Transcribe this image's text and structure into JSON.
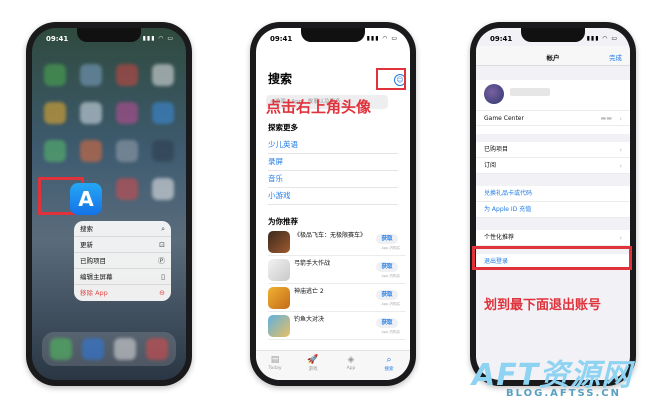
{
  "phone1": {
    "time": "09:41",
    "signal": "▮▮▮ ◠ ▭",
    "app_icon": "A",
    "menu": [
      {
        "label": "搜索",
        "icon": "search-icon",
        "glyph": "⌕"
      },
      {
        "label": "更新",
        "icon": "download-icon",
        "glyph": "⊡"
      },
      {
        "label": "已购项目",
        "icon": "purchased-icon",
        "glyph": "Ⓟ"
      },
      {
        "label": "编辑主屏幕",
        "icon": "phone-icon",
        "glyph": "▯"
      },
      {
        "label": "移除 App",
        "icon": "minus-circle-icon",
        "glyph": "⊖"
      }
    ],
    "danger_color": "#e24a4a"
  },
  "phone2": {
    "time": "09:41",
    "signal": "▮▮▮ ◠ ▭",
    "title": "搜索",
    "search_placeholder": "游戏、App、故事以及更多",
    "annotation": "点击右上角头像",
    "explore_heading": "探索更多",
    "explore_links": [
      "少儿英语",
      "录屏",
      "音乐",
      "小游戏"
    ],
    "recommend_heading": "为你推荐",
    "apps": [
      {
        "name": "《极品飞车：无极限赛车》",
        "get": "获取",
        "sub": "App 内购买"
      },
      {
        "name": "弓箭手大作战",
        "get": "获取",
        "sub": "App 内购买"
      },
      {
        "name": "神庙逃亡 2",
        "get": "获取",
        "sub": "App 内购买"
      },
      {
        "name": "钓鱼大对决",
        "get": "获取",
        "sub": "App 内购买"
      }
    ],
    "tabs": [
      {
        "label": "Today",
        "glyph": "▤"
      },
      {
        "label": "游戏",
        "glyph": "🚀"
      },
      {
        "label": "App",
        "glyph": "◈"
      },
      {
        "label": "搜索",
        "glyph": "⌕"
      }
    ],
    "accent": "#1f7ae5"
  },
  "phone3": {
    "time": "09:41",
    "signal": "▮▮▮ ◠ ▭",
    "title": "帐户",
    "done": "完成",
    "game_center": "Game Center",
    "rows1": [
      "已购项目",
      "订阅"
    ],
    "rows2": [
      "兑换礼品卡或代码",
      "为 Apple ID 充值"
    ],
    "personalized": "个性化推荐",
    "signout": "退出登录",
    "annotation": "划到最下面退出账号"
  },
  "watermark": {
    "main": "AFT资源网",
    "sub": "BLOG.AFTSS.CN"
  },
  "annotation_color": "#e0323b"
}
